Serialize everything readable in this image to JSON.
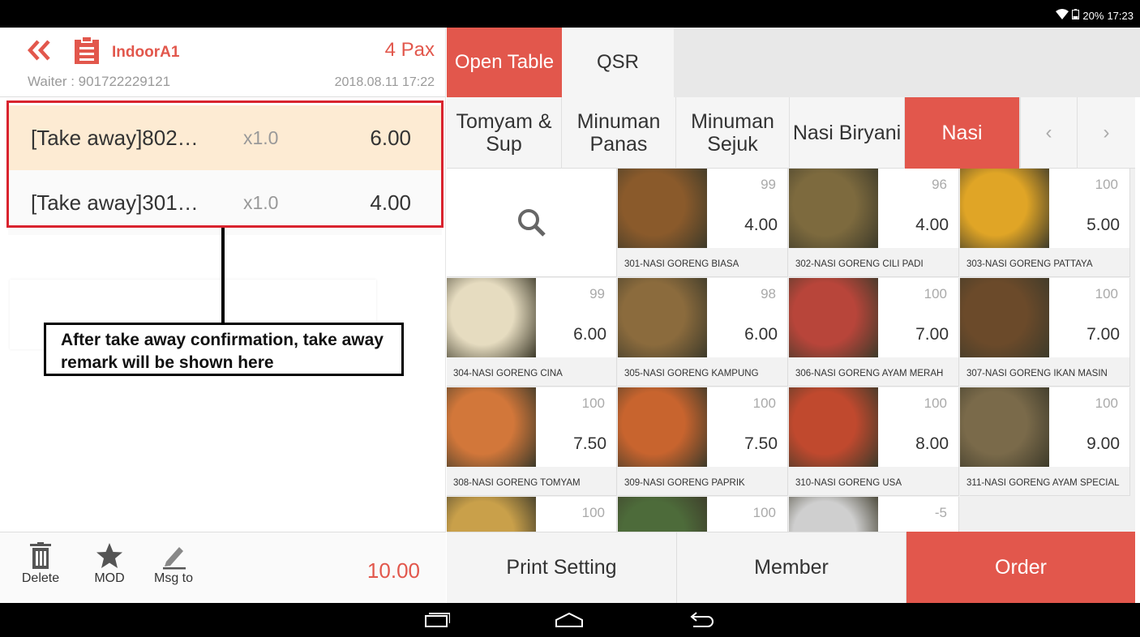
{
  "status_bar": {
    "battery": "20%",
    "time": "17:23"
  },
  "header": {
    "table_name": "IndoorA1",
    "pax": "4 Pax",
    "waiter": "Waiter : 901722229121",
    "datetime": "2018.08.11 17:22"
  },
  "order_items": [
    {
      "name": "[Take away]802…",
      "qty": "x1.0",
      "price": "6.00"
    },
    {
      "name": "[Take away]301…",
      "qty": "x1.0",
      "price": "4.00"
    }
  ],
  "callout": {
    "text": "After take away confirmation, take away remark will be shown here"
  },
  "footer_left": {
    "delete_label": "Delete",
    "mod_label": "MOD",
    "msg_label": "Msg to",
    "total": "10.00"
  },
  "tabs": [
    {
      "label": "Open Table",
      "active": true
    },
    {
      "label": "QSR",
      "active": false
    }
  ],
  "categories": [
    {
      "label": "Tomyam & Sup",
      "active": false
    },
    {
      "label": "Minuman Panas",
      "active": false
    },
    {
      "label": "Minuman Sejuk",
      "active": false
    },
    {
      "label": "Nasi Biryani",
      "active": false
    },
    {
      "label": "Nasi",
      "active": true
    }
  ],
  "category_nav": {
    "prev": "‹",
    "next": "›"
  },
  "menu_items": [
    {
      "stock": "99",
      "price": "4.00",
      "name": "301-NASI GORENG BIASA",
      "color": "#8a5a2b"
    },
    {
      "stock": "96",
      "price": "4.00",
      "name": "302-NASI GORENG CILI PADI",
      "color": "#7d6a3e"
    },
    {
      "stock": "100",
      "price": "5.00",
      "name": "303-NASI GORENG PATTAYA",
      "color": "#e0a526"
    },
    {
      "stock": "99",
      "price": "6.00",
      "name": "304-NASI GORENG CINA",
      "color": "#e6dcc0"
    },
    {
      "stock": "98",
      "price": "6.00",
      "name": "305-NASI GORENG KAMPUNG",
      "color": "#8b6b3d"
    },
    {
      "stock": "100",
      "price": "7.00",
      "name": "306-NASI GORENG AYAM MERAH",
      "color": "#b8453a"
    },
    {
      "stock": "100",
      "price": "7.00",
      "name": "307-NASI GORENG IKAN MASIN",
      "color": "#6b4a2a"
    },
    {
      "stock": "100",
      "price": "7.50",
      "name": "308-NASI GORENG TOMYAM",
      "color": "#d2773a"
    },
    {
      "stock": "100",
      "price": "7.50",
      "name": "309-NASI GORENG PAPRIK",
      "color": "#c8642e"
    },
    {
      "stock": "100",
      "price": "8.00",
      "name": "310-NASI GORENG USA",
      "color": "#c0492e"
    },
    {
      "stock": "100",
      "price": "9.00",
      "name": "311-NASI GORENG AYAM SPECIAL",
      "color": "#7a6a4a"
    },
    {
      "stock": "100",
      "price": "",
      "name": "",
      "color": "#c9a04a"
    },
    {
      "stock": "100",
      "price": "",
      "name": "",
      "color": "#4d6b3a"
    },
    {
      "stock": "-5",
      "price": "",
      "name": "",
      "color": "#cfcfcf"
    }
  ],
  "bottom_buttons": {
    "print_setting": "Print Setting",
    "member": "Member",
    "order": "Order"
  }
}
